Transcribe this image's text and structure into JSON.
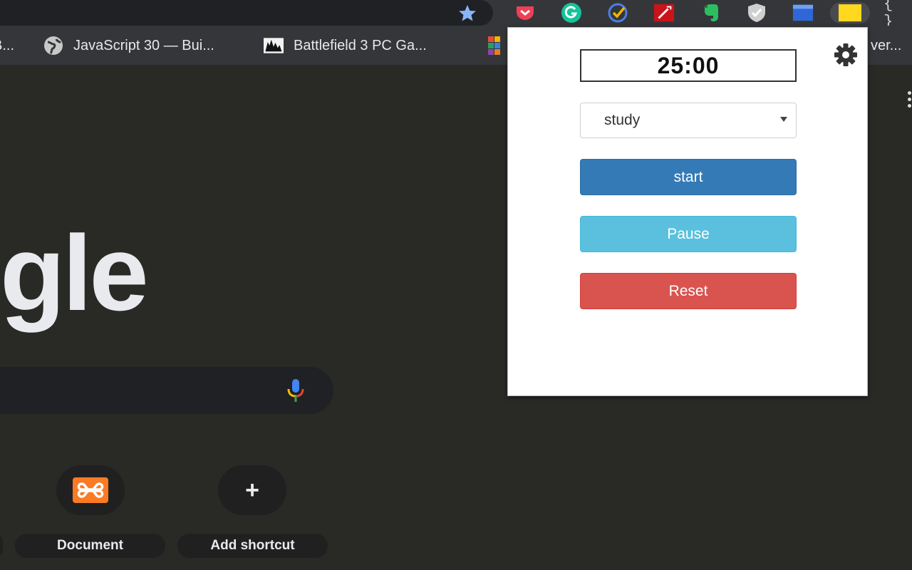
{
  "browser": {
    "toolbar_icons": [
      "star-icon",
      "pocket-icon",
      "grammarly-icon",
      "todoist-icon",
      "colorpicker-icon",
      "evernote-icon",
      "shield-icon",
      "window-icon",
      "pomodoro-icon"
    ],
    "devtools_label": "{ }"
  },
  "bookmarks": [
    {
      "label": "B...",
      "icon": "bookmark-icon"
    },
    {
      "label": "JavaScript 30 — Bui...",
      "icon": "globe-icon"
    },
    {
      "label": "Battlefield 3 PC Ga...",
      "icon": "bf3-icon"
    },
    {
      "label": "ver...",
      "icon": "bookmark-icon"
    }
  ],
  "ntp": {
    "logo_fragment": "gle",
    "shortcuts": [
      {
        "label": "Document",
        "icon": "xampp-icon"
      },
      {
        "label": "Add shortcut",
        "icon": "plus-icon",
        "glyph": "+"
      }
    ]
  },
  "popup": {
    "timer": "25:00",
    "mode_select": {
      "value": "study",
      "options": [
        "study"
      ]
    },
    "buttons": {
      "start": "start",
      "pause": "Pause",
      "reset": "Reset"
    },
    "colors": {
      "start": "#337ab7",
      "pause": "#5bc0de",
      "reset": "#d9534f"
    }
  }
}
